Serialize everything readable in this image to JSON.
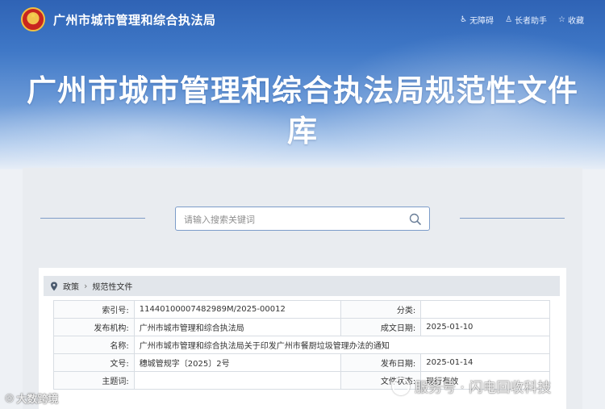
{
  "header": {
    "site_name": "广州市城市管理和综合执法局",
    "links": [
      {
        "label": "无障碍",
        "icon": "accessibility-icon"
      },
      {
        "label": "长者助手",
        "icon": "elder-helper-icon"
      },
      {
        "label": "收藏",
        "icon": "bookmark-icon"
      }
    ],
    "title": "广州市城市管理和综合执法局规范性文件库"
  },
  "search": {
    "placeholder": "请输入搜索关键词"
  },
  "breadcrumb": {
    "items": [
      "政策",
      "规范性文件"
    ]
  },
  "document": {
    "index_label": "索引号:",
    "index_value": "11440100007482989M/2025-00012",
    "category_label": "分类:",
    "category_value": "",
    "publisher_label": "发布机构:",
    "publisher_value": "广州市城市管理和综合执法局",
    "written_date_label": "成文日期:",
    "written_date_value": "2025-01-10",
    "name_label": "名称:",
    "name_value": "广州市城市管理和综合执法局关于印发广州市餐厨垃圾管理办法的通知",
    "doc_no_label": "文号:",
    "doc_no_value": "穗城管规字〔2025〕2号",
    "publish_date_label": "发布日期:",
    "publish_date_value": "2025-01-14",
    "keywords_label": "主题词:",
    "keywords_value": "",
    "status_label": "文件状态:",
    "status_value": "现行有效"
  },
  "watermarks": {
    "left": "大数跨境",
    "right": "服务号 · 闪电回收科技"
  },
  "colors": {
    "header_blue": "#2f63b5",
    "search_border": "#7c9cc9",
    "panel_bg": "#e9ecf0"
  }
}
